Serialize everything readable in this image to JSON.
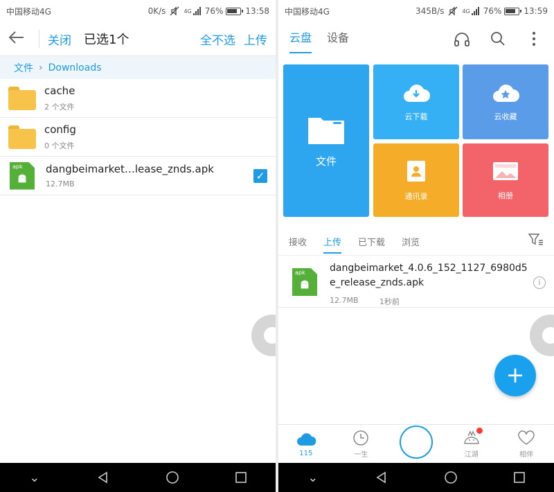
{
  "left": {
    "status": {
      "carrier": "中国移动4G",
      "speed": "0K/s",
      "network": "4G",
      "battery": "76%",
      "time": "13:58"
    },
    "header": {
      "close": "关闭",
      "title": "已选1个",
      "deselect_all": "全不选",
      "upload": "上传"
    },
    "breadcrumb": {
      "root": "文件",
      "current": "Downloads"
    },
    "files": [
      {
        "name": "cache",
        "sub": "2 个文件"
      },
      {
        "name": "config",
        "sub": "0 个文件"
      },
      {
        "name": "dangbeimarket…lease_znds.apk",
        "sub": "12.7MB",
        "badge": "apk"
      }
    ]
  },
  "right": {
    "status": {
      "carrier": "中国移动4G",
      "speed": "345B/s",
      "network": "4G",
      "battery": "76%",
      "time": "13:59"
    },
    "tabs": [
      "云盘",
      "设备"
    ],
    "tiles": {
      "files": "文件",
      "download": "云下载",
      "favorites": "云收藏",
      "contacts": "通讯录",
      "album": "相册"
    },
    "subtabs": [
      "接收",
      "上传",
      "已下载",
      "浏览"
    ],
    "upload_item": {
      "name": "dangbeimarket_4.0.6_152_1127_6980d5e_release_znds.apk",
      "size": "12.7MB",
      "time": "1秒前",
      "badge": "apk"
    },
    "fab": "+",
    "bottom_tabs": [
      "115",
      "一生",
      "江湖",
      "相伴"
    ]
  },
  "colors": {
    "accent": "#1e9be3",
    "folder": "#f7c34a",
    "apk": "#55b03a",
    "tile_orange": "#f5ac29",
    "tile_red": "#f2646a"
  }
}
